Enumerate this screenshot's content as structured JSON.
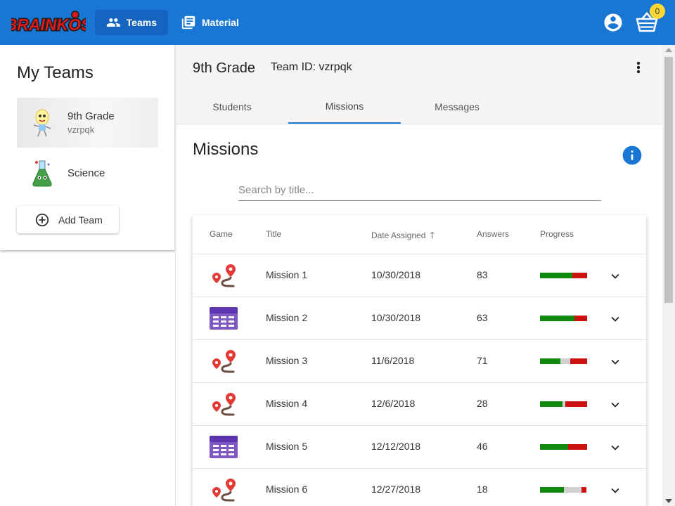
{
  "header": {
    "logo_text": "BRAINKOS",
    "nav": [
      {
        "label": "Teams",
        "icon": "people-icon",
        "active": true
      },
      {
        "label": "Material",
        "icon": "library-books-icon",
        "active": false
      }
    ],
    "basket_count": "0",
    "colors": {
      "bar": "#1976d2",
      "badge": "#fdd835"
    }
  },
  "sidebar": {
    "title": "My Teams",
    "teams": [
      {
        "name": "9th Grade",
        "id": "vzrpqk",
        "selected": true
      },
      {
        "name": "Science",
        "id": "",
        "selected": false
      }
    ],
    "add_label": "Add Team"
  },
  "team_header": {
    "name": "9th Grade",
    "id_label": "Team ID: vzrpqk"
  },
  "tabs": [
    {
      "label": "Students",
      "active": false
    },
    {
      "label": "Missions",
      "active": true
    },
    {
      "label": "Messages",
      "active": false
    }
  ],
  "missions": {
    "title": "Missions",
    "search_placeholder": "Search by title...",
    "columns": [
      "Game",
      "Title",
      "Date Assigned",
      "Answers",
      "Progress"
    ],
    "sort_column": "Date Assigned",
    "sort_direction": "ascending",
    "rows": [
      {
        "game": "map-game-icon",
        "title": "Mission 1",
        "date": "10/30/2018",
        "answers": "83",
        "progress": {
          "correct": 0.69,
          "pending": 0.0,
          "wrong": 0.31
        }
      },
      {
        "game": "table-game-icon",
        "title": "Mission 2",
        "date": "10/30/2018",
        "answers": "63",
        "progress": {
          "correct": 0.73,
          "pending": 0.0,
          "wrong": 0.27
        }
      },
      {
        "game": "map-game-icon",
        "title": "Mission 3",
        "date": "11/6/2018",
        "answers": "71",
        "progress": {
          "correct": 0.43,
          "pending": 0.21,
          "wrong": 0.36
        }
      },
      {
        "game": "map-game-icon",
        "title": "Mission 4",
        "date": "12/6/2018",
        "answers": "28",
        "progress": {
          "correct": 0.48,
          "pending": 0.06,
          "wrong": 0.46
        }
      },
      {
        "game": "table-game-icon",
        "title": "Mission 5",
        "date": "12/12/2018",
        "answers": "46",
        "progress": {
          "correct": 0.6,
          "pending": 0.0,
          "wrong": 0.4
        }
      },
      {
        "game": "map-game-icon",
        "title": "Mission 6",
        "date": "12/27/2018",
        "answers": "18",
        "progress": {
          "correct": 0.51,
          "pending": 0.38,
          "wrong": 0.11
        }
      }
    ],
    "progress_colors": {
      "correct": "#0f8a0f",
      "pending": "#d0d0d0",
      "wrong": "#cc1111"
    }
  }
}
